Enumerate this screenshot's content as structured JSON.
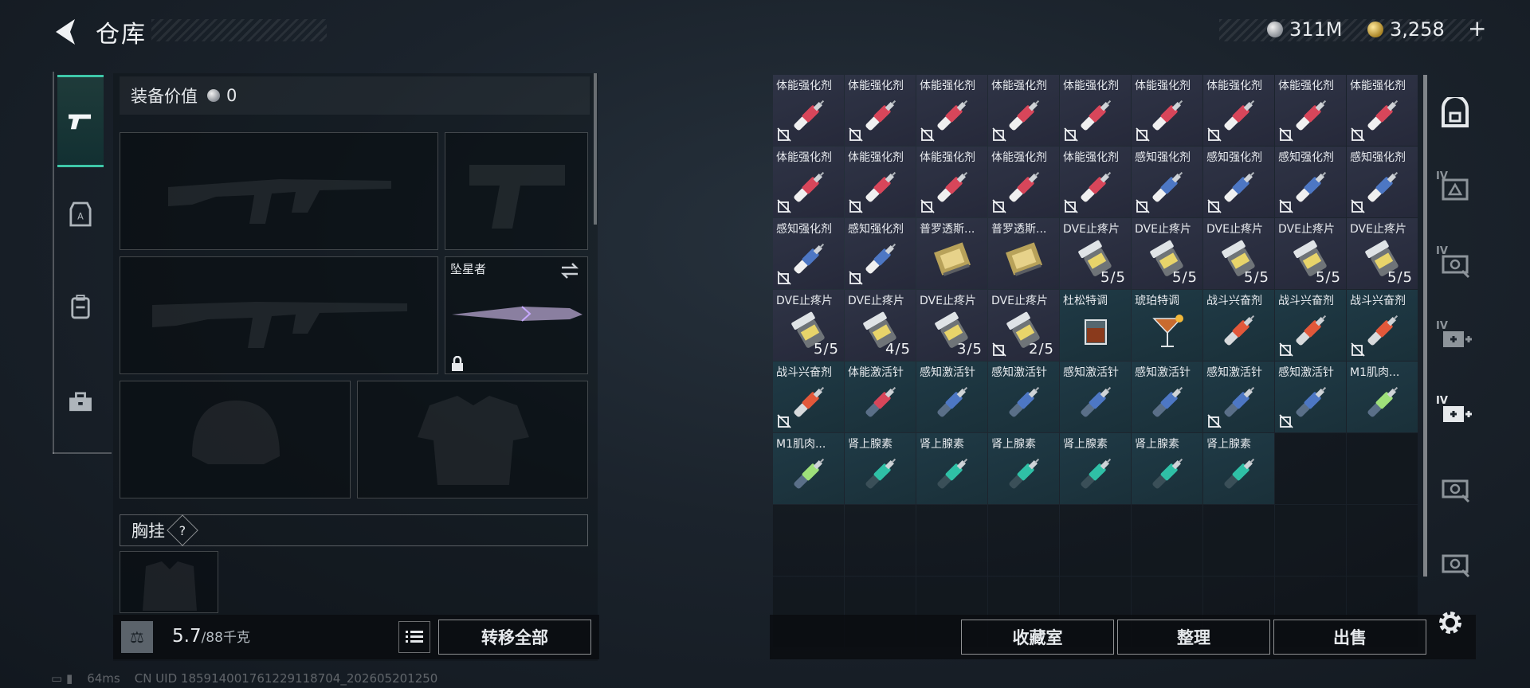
{
  "header": {
    "title": "仓库",
    "currency": [
      {
        "name": "silver-coin",
        "value": "311M"
      },
      {
        "name": "gold-coin",
        "value": "3,258"
      },
      {
        "name": "plus",
        "value": "+"
      }
    ]
  },
  "left_tabs": [
    {
      "icon": "pistol-icon",
      "active": true
    },
    {
      "icon": "armor-icon",
      "active": false
    },
    {
      "icon": "backpack-icon",
      "active": false
    },
    {
      "icon": "toolbox-icon",
      "active": false
    }
  ],
  "equipment": {
    "value_label": "装备价值",
    "value": "0",
    "melee_name": "坠星者",
    "chest_label": "胸挂",
    "chest_help": "?",
    "weight_current": "5.7",
    "weight_max": "/88千克",
    "transfer_all": "转移全部"
  },
  "inventory": {
    "colors": {
      "purple": "#2c3142",
      "teal": "#1e3642"
    },
    "rows": [
      [
        {
          "label": "体能强化剂",
          "icon": "syringe-red-icon",
          "tint": "purple",
          "locked": true
        },
        {
          "label": "体能强化剂",
          "icon": "syringe-red-icon",
          "tint": "purple",
          "locked": true
        },
        {
          "label": "体能强化剂",
          "icon": "syringe-red-icon",
          "tint": "purple",
          "locked": true
        },
        {
          "label": "体能强化剂",
          "icon": "syringe-red-icon",
          "tint": "purple",
          "locked": true
        },
        {
          "label": "体能强化剂",
          "icon": "syringe-red-icon",
          "tint": "purple",
          "locked": true
        },
        {
          "label": "体能强化剂",
          "icon": "syringe-red-icon",
          "tint": "purple",
          "locked": true
        },
        {
          "label": "体能强化剂",
          "icon": "syringe-red-icon",
          "tint": "purple",
          "locked": true
        },
        {
          "label": "体能强化剂",
          "icon": "syringe-red-icon",
          "tint": "purple",
          "locked": true
        },
        {
          "label": "体能强化剂",
          "icon": "syringe-red-icon",
          "tint": "purple",
          "locked": true
        }
      ],
      [
        {
          "label": "体能强化剂",
          "icon": "syringe-red-icon",
          "tint": "purple",
          "locked": true
        },
        {
          "label": "体能强化剂",
          "icon": "syringe-red-icon",
          "tint": "purple",
          "locked": true
        },
        {
          "label": "体能强化剂",
          "icon": "syringe-red-icon",
          "tint": "purple",
          "locked": true
        },
        {
          "label": "体能强化剂",
          "icon": "syringe-red-icon",
          "tint": "purple",
          "locked": true
        },
        {
          "label": "体能强化剂",
          "icon": "syringe-red-icon",
          "tint": "purple",
          "locked": true
        },
        {
          "label": "感知强化剂",
          "icon": "syringe-blue-icon",
          "tint": "purple",
          "locked": true
        },
        {
          "label": "感知强化剂",
          "icon": "syringe-blue-icon",
          "tint": "purple",
          "locked": true
        },
        {
          "label": "感知强化剂",
          "icon": "syringe-blue-icon",
          "tint": "purple",
          "locked": true
        },
        {
          "label": "感知强化剂",
          "icon": "syringe-blue-icon",
          "tint": "purple",
          "locked": true
        }
      ],
      [
        {
          "label": "感知强化剂",
          "icon": "syringe-blue-icon",
          "tint": "purple",
          "locked": true
        },
        {
          "label": "感知强化剂",
          "icon": "syringe-blue-icon",
          "tint": "purple",
          "locked": true
        },
        {
          "label": "普罗透斯...",
          "icon": "chip-icon",
          "tint": "purple",
          "locked": false
        },
        {
          "label": "普罗透斯...",
          "icon": "chip-icon",
          "tint": "purple",
          "locked": false
        },
        {
          "label": "DVE止疼片",
          "icon": "pill-bottle-icon",
          "tint": "purple",
          "locked": false,
          "count": "5/5"
        },
        {
          "label": "DVE止疼片",
          "icon": "pill-bottle-icon",
          "tint": "purple",
          "locked": false,
          "count": "5/5"
        },
        {
          "label": "DVE止疼片",
          "icon": "pill-bottle-icon",
          "tint": "purple",
          "locked": false,
          "count": "5/5"
        },
        {
          "label": "DVE止疼片",
          "icon": "pill-bottle-icon",
          "tint": "purple",
          "locked": false,
          "count": "5/5"
        },
        {
          "label": "DVE止疼片",
          "icon": "pill-bottle-icon",
          "tint": "purple",
          "locked": false,
          "count": "5/5"
        }
      ],
      [
        {
          "label": "DVE止疼片",
          "icon": "pill-bottle-icon",
          "tint": "purple",
          "locked": false,
          "count": "5/5"
        },
        {
          "label": "DVE止疼片",
          "icon": "pill-bottle-icon",
          "tint": "purple",
          "locked": false,
          "count": "4/5"
        },
        {
          "label": "DVE止疼片",
          "icon": "pill-bottle-icon",
          "tint": "purple",
          "locked": false,
          "count": "3/5"
        },
        {
          "label": "DVE止疼片",
          "icon": "pill-bottle-icon",
          "tint": "purple",
          "locked": true,
          "count": "2/5"
        },
        {
          "label": "杜松特调",
          "icon": "whiskey-glass-icon",
          "tint": "teal",
          "locked": false
        },
        {
          "label": "琥珀特调",
          "icon": "cocktail-glass-icon",
          "tint": "teal",
          "locked": false
        },
        {
          "label": "战斗兴奋剂",
          "icon": "syringe-orange-icon",
          "tint": "teal",
          "locked": false
        },
        {
          "label": "战斗兴奋剂",
          "icon": "syringe-orange-icon",
          "tint": "teal",
          "locked": true
        },
        {
          "label": "战斗兴奋剂",
          "icon": "syringe-orange-icon",
          "tint": "teal",
          "locked": true
        }
      ],
      [
        {
          "label": "战斗兴奋剂",
          "icon": "syringe-orange-icon",
          "tint": "teal",
          "locked": true
        },
        {
          "label": "体能激活针",
          "icon": "injector-red-icon",
          "tint": "teal",
          "locked": false
        },
        {
          "label": "感知激活针",
          "icon": "injector-blue-icon",
          "tint": "teal",
          "locked": false
        },
        {
          "label": "感知激活针",
          "icon": "injector-blue-icon",
          "tint": "teal",
          "locked": false
        },
        {
          "label": "感知激活针",
          "icon": "injector-blue-icon",
          "tint": "teal",
          "locked": false
        },
        {
          "label": "感知激活针",
          "icon": "injector-blue-icon",
          "tint": "teal",
          "locked": false
        },
        {
          "label": "感知激活针",
          "icon": "injector-blue-icon",
          "tint": "teal",
          "locked": true
        },
        {
          "label": "感知激活针",
          "icon": "injector-blue-icon",
          "tint": "teal",
          "locked": true
        },
        {
          "label": "M1肌肉...",
          "icon": "injector-green-icon",
          "tint": "teal",
          "locked": false
        }
      ],
      [
        {
          "label": "M1肌肉...",
          "icon": "injector-green-icon",
          "tint": "teal",
          "locked": false
        },
        {
          "label": "肾上腺素",
          "icon": "injector-teal-icon",
          "tint": "teal",
          "locked": false
        },
        {
          "label": "肾上腺素",
          "icon": "injector-teal-icon",
          "tint": "teal",
          "locked": false
        },
        {
          "label": "肾上腺素",
          "icon": "injector-teal-icon",
          "tint": "teal",
          "locked": false
        },
        {
          "label": "肾上腺素",
          "icon": "injector-teal-icon",
          "tint": "teal",
          "locked": false
        },
        {
          "label": "肾上腺素",
          "icon": "injector-teal-icon",
          "tint": "teal",
          "locked": false
        },
        {
          "label": "肾上腺素",
          "icon": "injector-teal-icon",
          "tint": "teal",
          "locked": false
        },
        {
          "label": "",
          "icon": "",
          "tint": "empty",
          "locked": false
        },
        {
          "label": "",
          "icon": "",
          "tint": "empty",
          "locked": false
        }
      ]
    ],
    "empty_rows": 2
  },
  "right_tabs": [
    {
      "icon": "safe-box-icon",
      "tier": ""
    },
    {
      "icon": "ammo-crate-icon",
      "tier": "IV"
    },
    {
      "icon": "cash-crate-icon",
      "tier": "IV"
    },
    {
      "icon": "med-crate-icon",
      "tier": "IV"
    },
    {
      "icon": "med-crate-icon",
      "tier": "IV"
    },
    {
      "icon": "cash-crate-icon",
      "tier": ""
    },
    {
      "icon": "cash-crate-icon",
      "tier": ""
    }
  ],
  "actions": {
    "collection": "收藏室",
    "sort": "整理",
    "sell": "出售"
  },
  "status": {
    "ping": "64ms",
    "uid": "CN UID 185914001761229118704_202605201250"
  }
}
